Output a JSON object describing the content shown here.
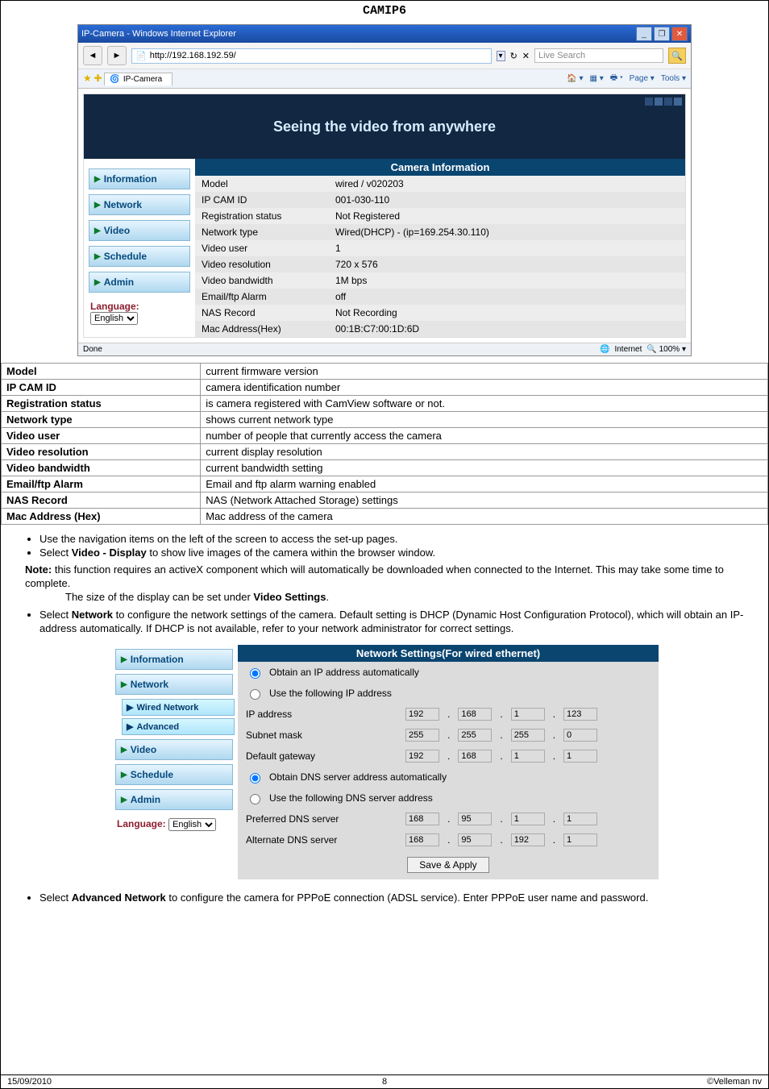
{
  "page": {
    "header": "CAMIP6",
    "footer_date": "15/09/2010",
    "footer_page": "8",
    "footer_company": "©Velleman nv"
  },
  "ie": {
    "title": "IP-Camera - Windows Internet Explorer",
    "url": "http://192.168.192.59/",
    "search_placeholder": "Live Search",
    "tab_label": "IP-Camera",
    "tool_page": "Page",
    "tool_tools": "Tools",
    "done": "Done",
    "zone": "Internet",
    "zoom": "100%"
  },
  "banner": {
    "text": "Seeing the video from anywhere"
  },
  "nav": {
    "information": "Information",
    "network": "Network",
    "video": "Video",
    "schedule": "Schedule",
    "admin": "Admin",
    "language_label": "Language:",
    "language_value": "English"
  },
  "camera_info": {
    "header": "Camera Information",
    "rows": [
      {
        "label": "Model",
        "value": "wired / v020203"
      },
      {
        "label": "IP CAM ID",
        "value": "001-030-110"
      },
      {
        "label": "Registration status",
        "value": "Not Registered"
      },
      {
        "label": "Network type",
        "value": "Wired(DHCP) - (ip=169.254.30.110)"
      },
      {
        "label": "Video user",
        "value": "1"
      },
      {
        "label": "Video resolution",
        "value": "720 x 576"
      },
      {
        "label": "Video bandwidth",
        "value": "1M bps"
      },
      {
        "label": "Email/ftp Alarm",
        "value": "off"
      },
      {
        "label": "NAS Record",
        "value": "Not Recording"
      },
      {
        "label": "Mac Address(Hex)",
        "value": "00:1B:C7:00:1D:6D"
      }
    ]
  },
  "info_table": [
    {
      "key": "Model",
      "val": "current firmware version"
    },
    {
      "key": "IP CAM ID",
      "val": "camera identification number"
    },
    {
      "key": "Registration status",
      "val": "is camera registered with CamView software or not."
    },
    {
      "key": "Network type",
      "val": "shows current network type"
    },
    {
      "key": "Video user",
      "val": "number of people that currently access the camera"
    },
    {
      "key": "Video resolution",
      "val": "current display resolution"
    },
    {
      "key": "Video bandwidth",
      "val": "current bandwidth setting"
    },
    {
      "key": "Email/ftp Alarm",
      "val": "Email and ftp alarm warning enabled"
    },
    {
      "key": "NAS Record",
      "val": "NAS (Network Attached Storage) settings"
    },
    {
      "key": "Mac Address (Hex)",
      "val": "Mac address of the camera"
    }
  ],
  "bullets": {
    "b1": "Use the navigation items on the left of the screen to access the set-up pages.",
    "b2_pre": "Select ",
    "b2_bold": "Video - Display",
    "b2_post": " to show live images of the camera within the browser window.",
    "note_label": "Note:",
    "note_text": " this function requires an activeX component which will automatically be downloaded when connected to the Internet. This may take some time to complete.",
    "note_line2_pre": "The size of the display can be set under ",
    "note_line2_bold": "Video Settings",
    "note_line2_post": ".",
    "b3_pre": "Select ",
    "b3_bold": "Network",
    "b3_post": " to configure the network settings of the camera. Default setting is DHCP (Dynamic Host Configuration Protocol), which will obtain an IP-address automatically. If DHCP is not available, refer to your network administrator for correct settings.",
    "b4_pre": "Select ",
    "b4_bold": "Advanced Network",
    "b4_post": " to configure the camera for PPPoE connection (ADSL service). Enter PPPoE user name and password."
  },
  "subnav": {
    "wired": "Wired Network",
    "advanced": "Advanced"
  },
  "net": {
    "header": "Network Settings(For wired ethernet)",
    "auto_ip": "Obtain an IP address automatically",
    "manual_ip": "Use the following IP address",
    "ip_addr_label": "IP address",
    "ip_addr": [
      "192",
      "168",
      "1",
      "123"
    ],
    "subnet_label": "Subnet mask",
    "subnet": [
      "255",
      "255",
      "255",
      "0"
    ],
    "gateway_label": "Default gateway",
    "gateway": [
      "192",
      "168",
      "1",
      "1"
    ],
    "auto_dns": "Obtain DNS server address automatically",
    "manual_dns": "Use the following DNS server address",
    "pref_dns_label": "Preferred DNS server",
    "pref_dns": [
      "168",
      "95",
      "1",
      "1"
    ],
    "alt_dns_label": "Alternate DNS server",
    "alt_dns": [
      "168",
      "95",
      "192",
      "1"
    ],
    "save": "Save & Apply"
  }
}
